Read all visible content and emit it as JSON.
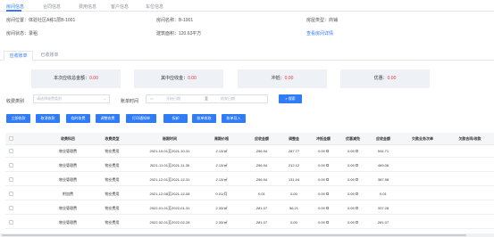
{
  "tabs": [
    "房间信息",
    "合同信息",
    "费用信息",
    "客户信息",
    "车位信息"
  ],
  "info": {
    "location_label": "房间位置：体验社区A栋1层B-1001",
    "name_label": "房间名称：B-1001",
    "type_label": "房屋类型：商铺",
    "status_label": "房间状态：录租",
    "area_label": "建筑面积：120.63平方",
    "detail_link": "查看房间详情"
  },
  "subtabs": [
    "应收账单",
    "已收账单"
  ],
  "stats": [
    {
      "label": "本次应收总金额：",
      "value": "0.00"
    },
    {
      "label": "其中应收金：",
      "value": "0.00"
    },
    {
      "label": "冲抵：",
      "value": "0.00"
    },
    {
      "label": "优惠：",
      "value": "0.00"
    }
  ],
  "filter": {
    "category_label": "收费类别",
    "category_placeholder": "请选择收费类别",
    "date_label": "账单时间",
    "start_placeholder": "开始日期",
    "sep": "至",
    "end_placeholder": "结束日期",
    "search_label": "搜索"
  },
  "actions": [
    "立即收款",
    "取消收款",
    "临时收费",
    "调整收费",
    "打印通知单",
    "拆卸",
    "账单收取",
    "账单导入"
  ],
  "table": {
    "headers": [
      "收费科目",
      "收费类型",
      "账期时间",
      "周期价格",
      "应收金额",
      "调整金",
      "冲抵金额",
      "优惠减免",
      "应收金额",
      "欠款业务次单",
      "欠款合同/收款"
    ],
    "rows": [
      [
        "物业管理费",
        "物业费用",
        "2021-10-01至2021-10-31",
        "2.13/㎡",
        "256.94",
        "287.77",
        "0.00",
        "0.00",
        "544.71",
        "",
        ""
      ],
      [
        "物业管理费",
        "物业费用",
        "2021-11-01至2021-11-30",
        "2.13/㎡",
        "256.94",
        "212.12",
        "0.00",
        "0.00",
        "469.06",
        "",
        ""
      ],
      [
        "物业管理费",
        "物业费用",
        "2021-12-01至2021-12-31",
        "2.13/㎡",
        "256.94",
        "131.04",
        "0.00",
        "0.00",
        "387.98",
        "",
        ""
      ],
      [
        "附加费",
        "物业费用",
        "2021-12-08至2021-12-08",
        "0.01/月",
        "0.01",
        "0.00",
        "0.00",
        "0.00",
        "0.01",
        "",
        ""
      ],
      [
        "物业管理费",
        "物业费用",
        "2022-01-01至2022-01-31",
        "2.33/㎡",
        "281.07",
        "56.21",
        "0.00",
        "0.00",
        "337.28",
        "",
        ""
      ],
      [
        "物业管理费",
        "物业费用",
        "2022-02-01至2022-02-28",
        "2.33/㎡",
        "281.07",
        "0.00",
        "0.00",
        "0.00",
        "281.07",
        "",
        ""
      ]
    ]
  },
  "colors": {
    "accent": "#2f7cf6",
    "alert": "#e23b3b",
    "stat_bg": "#eef1f6"
  }
}
